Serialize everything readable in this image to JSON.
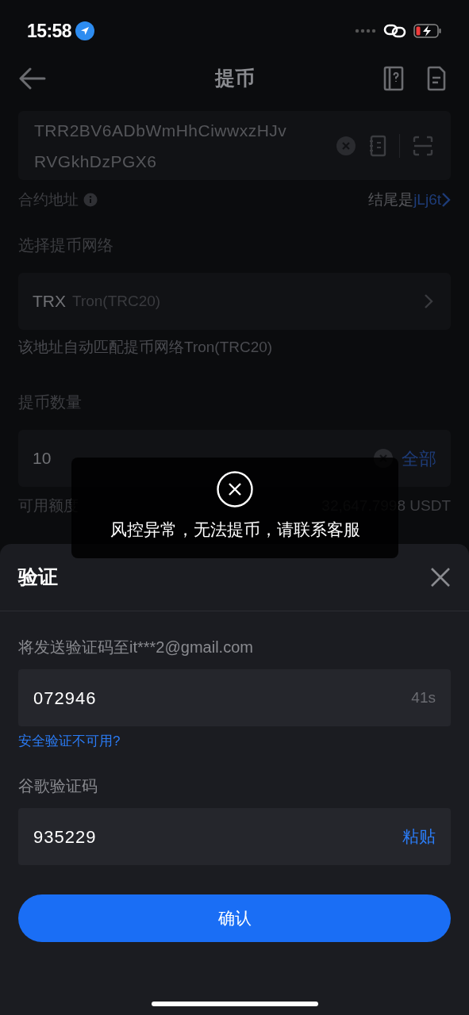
{
  "status_bar": {
    "time": "15:58"
  },
  "nav": {
    "title": "提币"
  },
  "address_field": {
    "value": "TRR2BV6ADbWmHhCiwwxzHJvRVGkhDzPGX6"
  },
  "contract": {
    "label": "合约地址",
    "ending_label": "结尾是",
    "ending_value": "jLj6t"
  },
  "network": {
    "label": "选择提币网络",
    "symbol": "TRX",
    "name": "Tron(TRC20)",
    "hint": "该地址自动匹配提币网络Tron(TRC20)"
  },
  "amount": {
    "label": "提币数量",
    "value": "10",
    "all_button": "全部",
    "available_label": "可用额度",
    "available_value": "32,647.7998 USDT"
  },
  "toast": {
    "message": "风控异常，无法提币，请联系客服"
  },
  "sheet": {
    "title": "验证",
    "fields": [
      {
        "kind": "email",
        "label": "将发送验证码至it***2@gmail.com",
        "value": "072946",
        "suffix": "41s",
        "link": "安全验证不可用?"
      },
      {
        "kind": "google",
        "label": "谷歌验证码",
        "value": "935229",
        "suffix": "粘贴"
      }
    ],
    "confirm_button": "确认"
  }
}
